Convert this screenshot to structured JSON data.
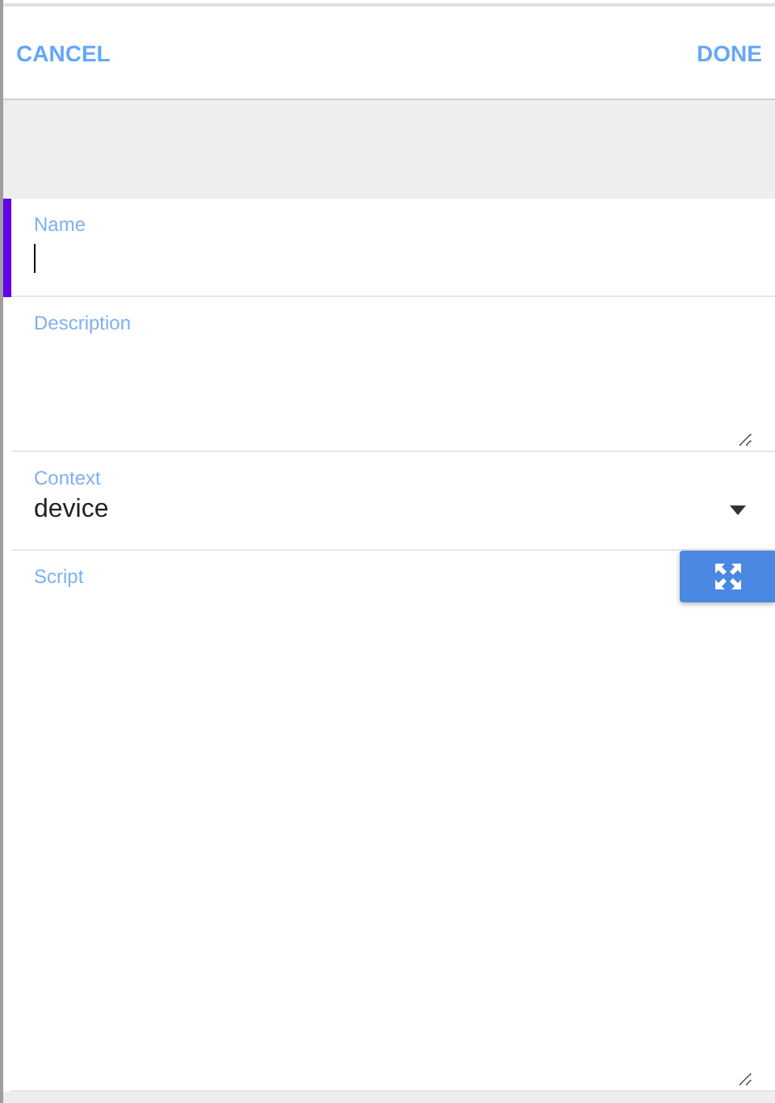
{
  "header": {
    "cancel": "CANCEL",
    "done": "DONE"
  },
  "fields": [
    {
      "kind": "text",
      "label": "Name",
      "focused": true
    },
    {
      "kind": "textarea",
      "label": "Description",
      "focused": false
    },
    {
      "kind": "select",
      "label": "Context",
      "value": "device",
      "focused": false
    },
    {
      "kind": "code",
      "label": "Script",
      "focused": false
    }
  ]
}
